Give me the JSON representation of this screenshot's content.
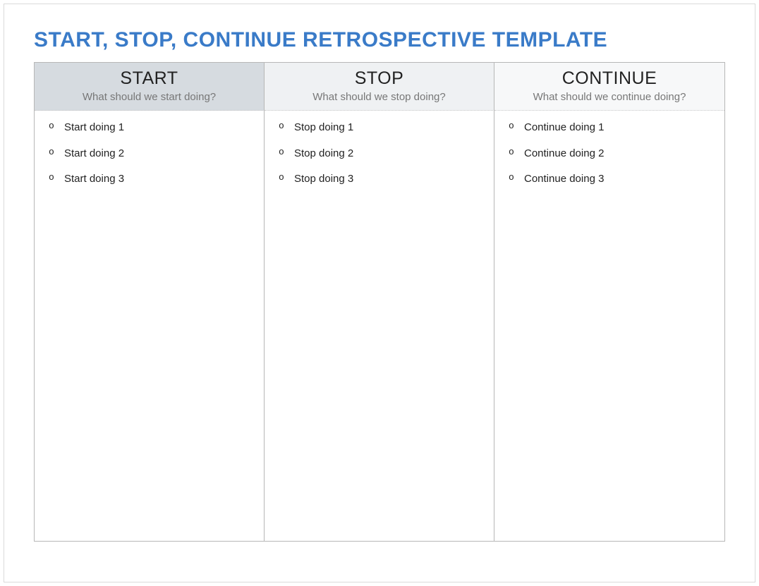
{
  "title": "START, STOP, CONTINUE RETROSPECTIVE TEMPLATE",
  "columns": {
    "start": {
      "heading": "START",
      "subheading": "What should we start doing?",
      "items": [
        "Start doing 1",
        "Start doing 2",
        "Start doing 3"
      ]
    },
    "stop": {
      "heading": "STOP",
      "subheading": "What should we stop doing?",
      "items": [
        "Stop doing 1",
        "Stop doing 2",
        "Stop doing 3"
      ]
    },
    "continue": {
      "heading": "CONTINUE",
      "subheading": "What should we continue doing?",
      "items": [
        "Continue doing 1",
        "Continue doing 2",
        "Continue doing 3"
      ]
    }
  }
}
